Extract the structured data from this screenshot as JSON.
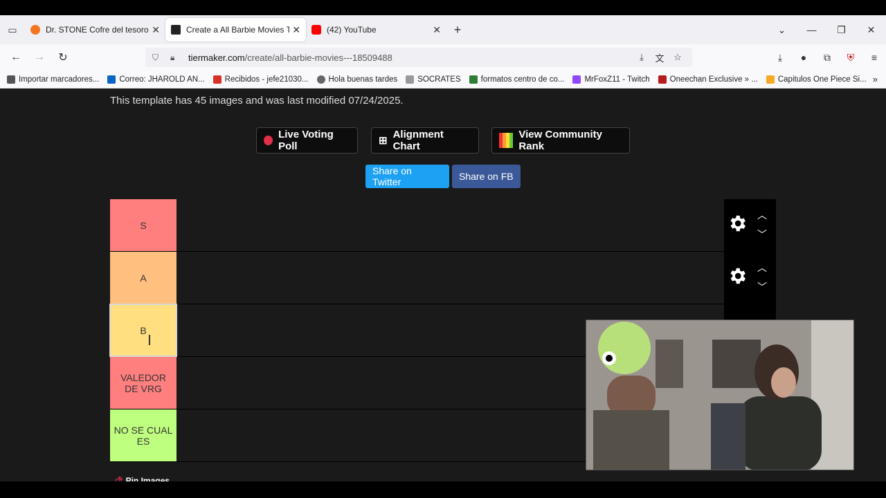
{
  "tabs": [
    {
      "title": "Dr. STONE Cofre del tesoro - Ve",
      "icon": "crunchyroll-icon",
      "color": "#f47521"
    },
    {
      "title": "Create a All Barbie Movies Tier L",
      "icon": "tiermaker-icon",
      "color": "#222222"
    },
    {
      "title": "(42) YouTube",
      "icon": "youtube-icon",
      "color": "#ff0000"
    }
  ],
  "url": {
    "host": "tiermaker.com",
    "path": "/create/all-barbie-movies---18509488"
  },
  "bookmarks": [
    {
      "label": "Importar marcadores...",
      "color": "#555555"
    },
    {
      "label": "Correo: JHAROLD AN...",
      "color": "#0a64c8"
    },
    {
      "label": "Recibidos - jefe21030...",
      "color": "#d93025"
    },
    {
      "label": "Hola buenas tardes",
      "color": "#666666"
    },
    {
      "label": "SOCRATES",
      "color": "#999999"
    },
    {
      "label": "formatos centro de co...",
      "color": "#2e7d32"
    },
    {
      "label": "MrFoxZ11 - Twitch",
      "color": "#9146ff"
    },
    {
      "label": "Oneechan Exclusive » ...",
      "color": "#b71c1c"
    },
    {
      "label": "Capitulos One Piece Si...",
      "color": "#f9a825"
    }
  ],
  "template_info": "This template has 45 images and was last modified 07/24/2025.",
  "buttons": {
    "live_voting": "Live Voting Poll",
    "alignment": "Alignment Chart",
    "community": "View Community Rank",
    "share_twitter": "Share on Twitter",
    "share_fb": "Share on FB"
  },
  "tiers": [
    {
      "label": "S",
      "color": "#ff7f7f"
    },
    {
      "label": "A",
      "color": "#ffbf7f"
    },
    {
      "label": "B",
      "color": "#ffdf7f"
    },
    {
      "label": "VALEDOR DE VRG",
      "color": "#ff7f7f"
    },
    {
      "label": "NO SE CUAL ES",
      "color": "#bfff7f"
    }
  ],
  "pin_label": "Pin Images"
}
